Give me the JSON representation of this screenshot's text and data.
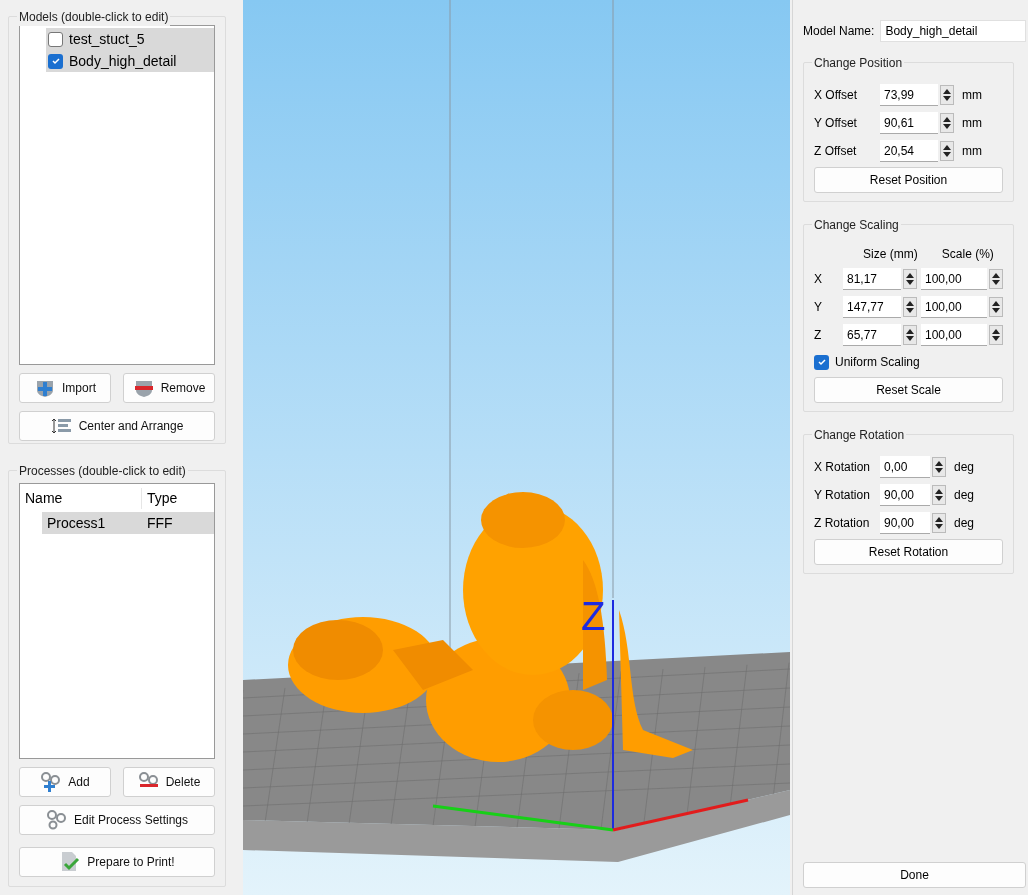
{
  "models_panel": {
    "title": "Models (double-click to edit)",
    "items": [
      {
        "name": "test_stuct_5",
        "checked": false,
        "selected": true
      },
      {
        "name": "Body_high_detail",
        "checked": true,
        "selected": true
      }
    ],
    "buttons": [
      {
        "label": "Import",
        "kind": "import"
      },
      {
        "label": "Remove",
        "kind": "remove"
      },
      {
        "label": "Center and Arrange",
        "kind": "arrange"
      }
    ]
  },
  "processes_panel": {
    "title": "Processes (double-click to edit)",
    "columns": [
      "Name",
      "Type"
    ],
    "rows": [
      {
        "cells": [
          "Process1",
          "FFF"
        ],
        "selected": true
      }
    ],
    "buttons": [
      {
        "label": "Add",
        "kind": "add"
      },
      {
        "label": "Delete",
        "kind": "delete"
      },
      {
        "label": "Edit Process Settings",
        "kind": "settings"
      },
      {
        "label": "Prepare to Print!",
        "kind": "print"
      }
    ]
  },
  "viewport": {
    "axis_label": "Z"
  },
  "properties": {
    "model_name": {
      "label": "Model Name:",
      "value": "Body_high_detail"
    },
    "position": {
      "title": "Change Position",
      "rows": [
        {
          "label": "X Offset",
          "value": "73,99",
          "unit": "mm"
        },
        {
          "label": "Y Offset",
          "value": "90,61",
          "unit": "mm"
        },
        {
          "label": "Z Offset",
          "value": "20,54",
          "unit": "mm"
        }
      ],
      "button": "Reset Position"
    },
    "scaling": {
      "title": "Change Scaling",
      "columns": [
        "Size (mm)",
        "Scale (%)"
      ],
      "rows": [
        {
          "axis": "X",
          "size": "81,17",
          "scale": "100,00"
        },
        {
          "axis": "Y",
          "size": "147,77",
          "scale": "100,00"
        },
        {
          "axis": "Z",
          "size": "65,77",
          "scale": "100,00"
        }
      ],
      "uniform": {
        "label": "Uniform Scaling",
        "checked": true
      },
      "button": "Reset Scale"
    },
    "rotation": {
      "title": "Change Rotation",
      "rows": [
        {
          "label": "X Rotation",
          "value": "0,00",
          "unit": "deg"
        },
        {
          "label": "Y Rotation",
          "value": "90,00",
          "unit": "deg"
        },
        {
          "label": "Z Rotation",
          "value": "90,00",
          "unit": "deg"
        }
      ],
      "button": "Reset Rotation"
    },
    "done": "Done"
  }
}
